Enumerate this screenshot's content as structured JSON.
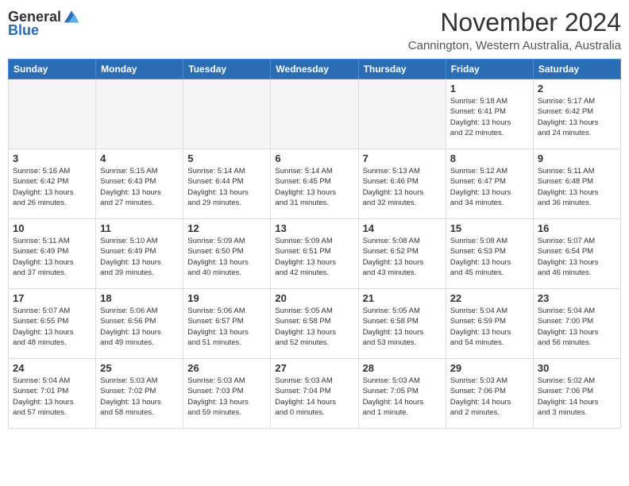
{
  "header": {
    "logo_general": "General",
    "logo_blue": "Blue",
    "month_title": "November 2024",
    "location": "Cannington, Western Australia, Australia"
  },
  "weekdays": [
    "Sunday",
    "Monday",
    "Tuesday",
    "Wednesday",
    "Thursday",
    "Friday",
    "Saturday"
  ],
  "weeks": [
    [
      {
        "day": "",
        "info": ""
      },
      {
        "day": "",
        "info": ""
      },
      {
        "day": "",
        "info": ""
      },
      {
        "day": "",
        "info": ""
      },
      {
        "day": "",
        "info": ""
      },
      {
        "day": "1",
        "info": "Sunrise: 5:18 AM\nSunset: 6:41 PM\nDaylight: 13 hours\nand 22 minutes."
      },
      {
        "day": "2",
        "info": "Sunrise: 5:17 AM\nSunset: 6:42 PM\nDaylight: 13 hours\nand 24 minutes."
      }
    ],
    [
      {
        "day": "3",
        "info": "Sunrise: 5:16 AM\nSunset: 6:42 PM\nDaylight: 13 hours\nand 26 minutes."
      },
      {
        "day": "4",
        "info": "Sunrise: 5:15 AM\nSunset: 6:43 PM\nDaylight: 13 hours\nand 27 minutes."
      },
      {
        "day": "5",
        "info": "Sunrise: 5:14 AM\nSunset: 6:44 PM\nDaylight: 13 hours\nand 29 minutes."
      },
      {
        "day": "6",
        "info": "Sunrise: 5:14 AM\nSunset: 6:45 PM\nDaylight: 13 hours\nand 31 minutes."
      },
      {
        "day": "7",
        "info": "Sunrise: 5:13 AM\nSunset: 6:46 PM\nDaylight: 13 hours\nand 32 minutes."
      },
      {
        "day": "8",
        "info": "Sunrise: 5:12 AM\nSunset: 6:47 PM\nDaylight: 13 hours\nand 34 minutes."
      },
      {
        "day": "9",
        "info": "Sunrise: 5:11 AM\nSunset: 6:48 PM\nDaylight: 13 hours\nand 36 minutes."
      }
    ],
    [
      {
        "day": "10",
        "info": "Sunrise: 5:11 AM\nSunset: 6:49 PM\nDaylight: 13 hours\nand 37 minutes."
      },
      {
        "day": "11",
        "info": "Sunrise: 5:10 AM\nSunset: 6:49 PM\nDaylight: 13 hours\nand 39 minutes."
      },
      {
        "day": "12",
        "info": "Sunrise: 5:09 AM\nSunset: 6:50 PM\nDaylight: 13 hours\nand 40 minutes."
      },
      {
        "day": "13",
        "info": "Sunrise: 5:09 AM\nSunset: 6:51 PM\nDaylight: 13 hours\nand 42 minutes."
      },
      {
        "day": "14",
        "info": "Sunrise: 5:08 AM\nSunset: 6:52 PM\nDaylight: 13 hours\nand 43 minutes."
      },
      {
        "day": "15",
        "info": "Sunrise: 5:08 AM\nSunset: 6:53 PM\nDaylight: 13 hours\nand 45 minutes."
      },
      {
        "day": "16",
        "info": "Sunrise: 5:07 AM\nSunset: 6:54 PM\nDaylight: 13 hours\nand 46 minutes."
      }
    ],
    [
      {
        "day": "17",
        "info": "Sunrise: 5:07 AM\nSunset: 6:55 PM\nDaylight: 13 hours\nand 48 minutes."
      },
      {
        "day": "18",
        "info": "Sunrise: 5:06 AM\nSunset: 6:56 PM\nDaylight: 13 hours\nand 49 minutes."
      },
      {
        "day": "19",
        "info": "Sunrise: 5:06 AM\nSunset: 6:57 PM\nDaylight: 13 hours\nand 51 minutes."
      },
      {
        "day": "20",
        "info": "Sunrise: 5:05 AM\nSunset: 6:58 PM\nDaylight: 13 hours\nand 52 minutes."
      },
      {
        "day": "21",
        "info": "Sunrise: 5:05 AM\nSunset: 6:58 PM\nDaylight: 13 hours\nand 53 minutes."
      },
      {
        "day": "22",
        "info": "Sunrise: 5:04 AM\nSunset: 6:59 PM\nDaylight: 13 hours\nand 54 minutes."
      },
      {
        "day": "23",
        "info": "Sunrise: 5:04 AM\nSunset: 7:00 PM\nDaylight: 13 hours\nand 56 minutes."
      }
    ],
    [
      {
        "day": "24",
        "info": "Sunrise: 5:04 AM\nSunset: 7:01 PM\nDaylight: 13 hours\nand 57 minutes."
      },
      {
        "day": "25",
        "info": "Sunrise: 5:03 AM\nSunset: 7:02 PM\nDaylight: 13 hours\nand 58 minutes."
      },
      {
        "day": "26",
        "info": "Sunrise: 5:03 AM\nSunset: 7:03 PM\nDaylight: 13 hours\nand 59 minutes."
      },
      {
        "day": "27",
        "info": "Sunrise: 5:03 AM\nSunset: 7:04 PM\nDaylight: 14 hours\nand 0 minutes."
      },
      {
        "day": "28",
        "info": "Sunrise: 5:03 AM\nSunset: 7:05 PM\nDaylight: 14 hours\nand 1 minute."
      },
      {
        "day": "29",
        "info": "Sunrise: 5:03 AM\nSunset: 7:06 PM\nDaylight: 14 hours\nand 2 minutes."
      },
      {
        "day": "30",
        "info": "Sunrise: 5:02 AM\nSunset: 7:06 PM\nDaylight: 14 hours\nand 3 minutes."
      }
    ]
  ]
}
